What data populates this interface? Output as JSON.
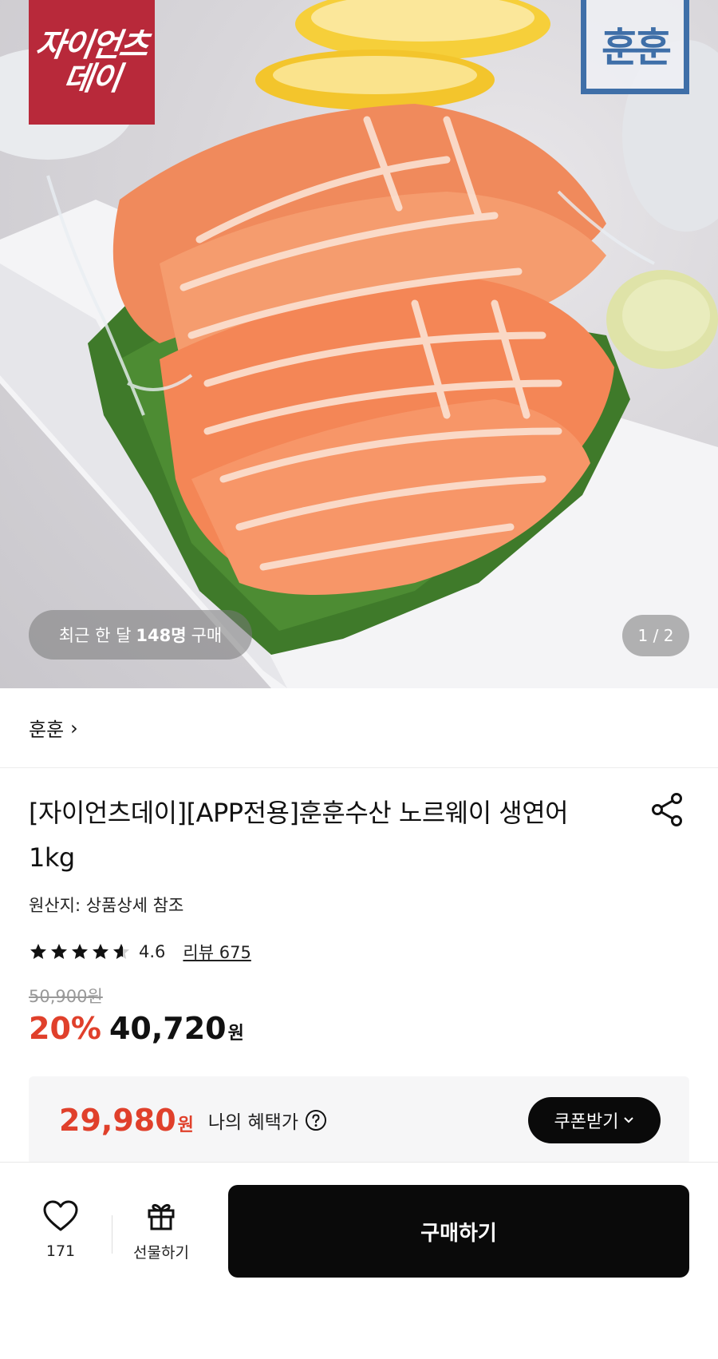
{
  "hero": {
    "brand_logo_line1": "자이언츠",
    "brand_logo_line2": "데이",
    "seller_logo_text": "훈훈",
    "purchase_prefix": "최근 한 달",
    "purchase_count": "148명",
    "purchase_suffix": "구매",
    "page_indicator": "1 / 2"
  },
  "seller": {
    "name": "훈훈",
    "chevron": "›"
  },
  "product": {
    "title": "[자이언츠데이][APP전용]훈훈수산 노르웨이 생연어 1kg",
    "origin": "원산지: 상품상세 참조",
    "rating": "4.6",
    "rating_stars": 4.6,
    "review_link": "리뷰 675",
    "original_price": "50,900원",
    "discount": "20%",
    "price": "40,720",
    "price_unit": "원"
  },
  "benefit": {
    "price": "29,980",
    "price_unit": "원",
    "label": "나의 혜택가",
    "coupon_button": "쿠폰받기"
  },
  "bottom": {
    "like_count": "171",
    "gift_label": "선물하기",
    "buy_label": "구매하기"
  },
  "colors": {
    "accent_red": "#e0402b",
    "brand_red": "#b8293a",
    "seller_blue": "#3f6fa8",
    "button_black": "#0a0a0a"
  },
  "icons": [
    "share-icon",
    "star-icon",
    "help-icon",
    "chevron-down-icon",
    "heart-icon",
    "gift-icon",
    "chevron-right-icon"
  ]
}
